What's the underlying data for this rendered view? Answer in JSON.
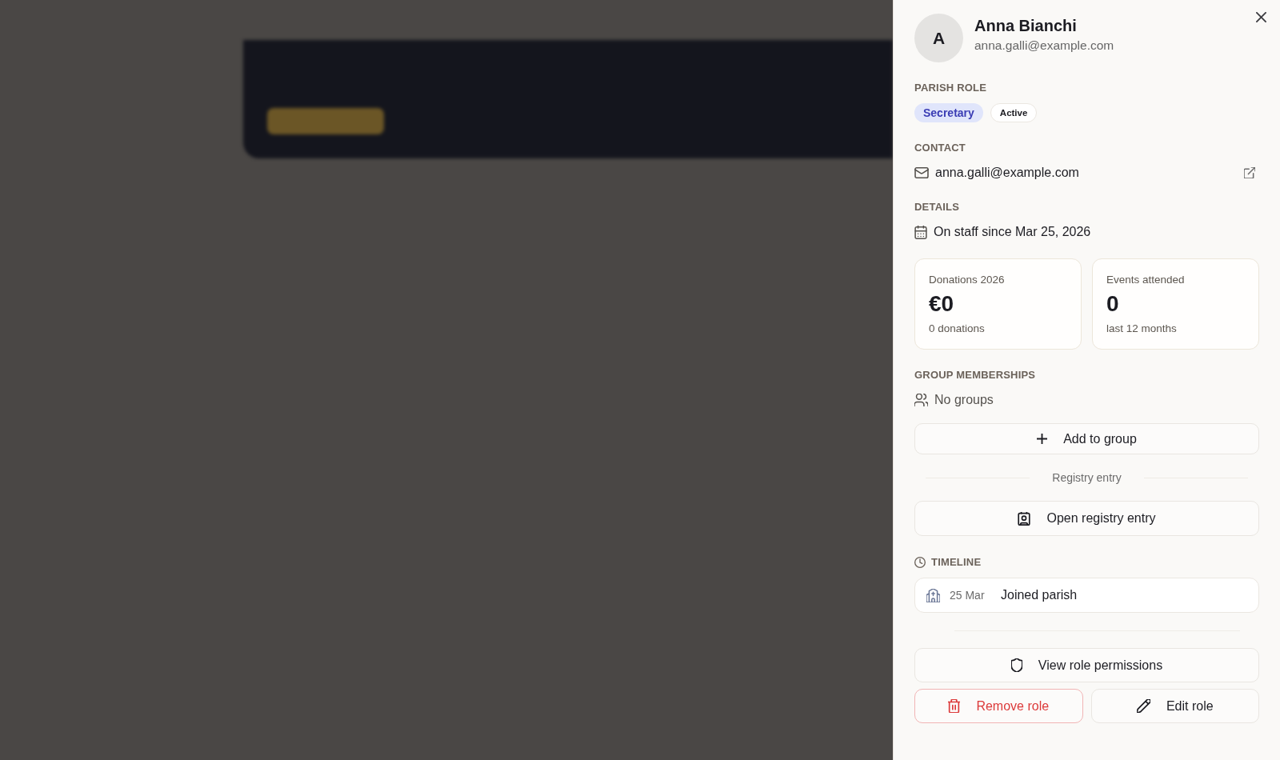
{
  "profile": {
    "avatar_initial": "A",
    "name": "Anna Bianchi",
    "email": "anna.galli@example.com"
  },
  "parish_role": {
    "heading": "PARISH ROLE",
    "badges": [
      {
        "label": "Secretary",
        "kind": "role"
      },
      {
        "label": "Active",
        "kind": "status"
      }
    ]
  },
  "contact": {
    "heading": "CONTACT",
    "email": "anna.galli@example.com"
  },
  "details": {
    "heading": "DETAILS",
    "staff_since": "On staff since Mar 25, 2026"
  },
  "stats": [
    {
      "label": "Donations 2026",
      "value": "€0",
      "note": "0 donations"
    },
    {
      "label": "Events attended",
      "value": "0",
      "note": "last 12 months"
    }
  ],
  "groups": {
    "heading": "GROUP MEMBERSHIPS",
    "empty_text": "No groups",
    "add_button": "Add to group"
  },
  "registry": {
    "divider_label": "Registry entry",
    "open_button": "Open registry entry"
  },
  "timeline": {
    "heading": "TIMELINE",
    "events": [
      {
        "date": "25 Mar",
        "text": "Joined parish"
      }
    ]
  },
  "actions": [
    {
      "label": "View role permissions",
      "kind": "permissions"
    },
    {
      "label": "Remove role",
      "kind": "danger"
    },
    {
      "label": "Edit role",
      "kind": "edit"
    }
  ]
}
